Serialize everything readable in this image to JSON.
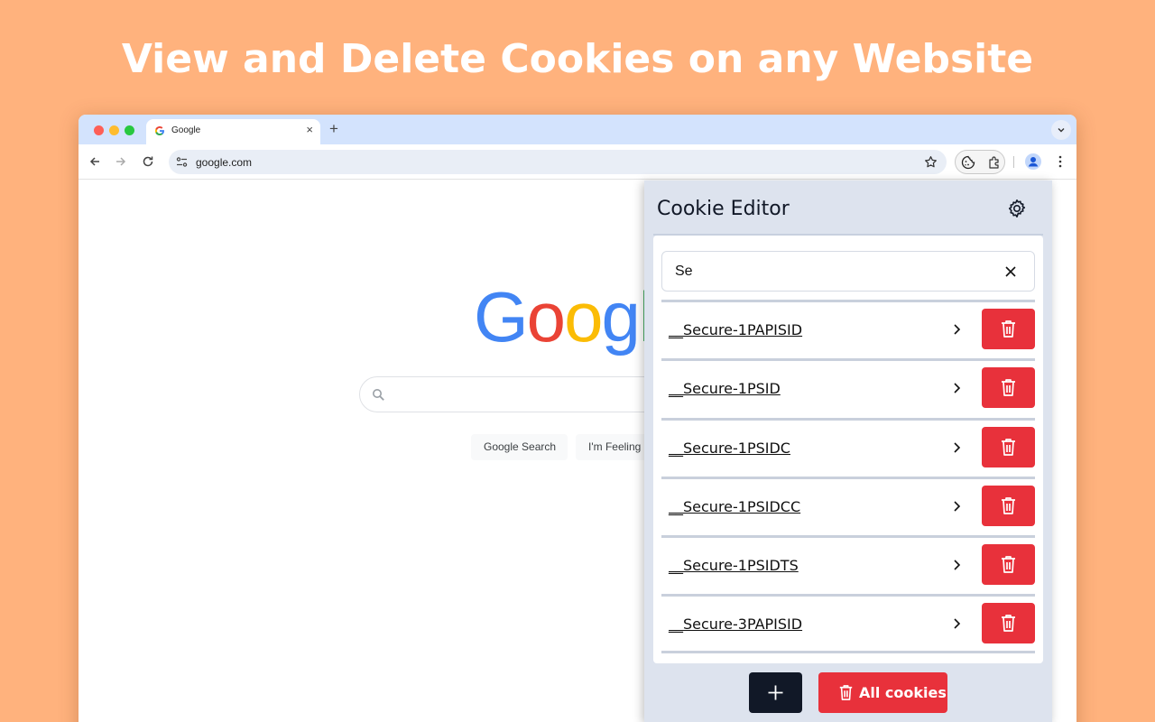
{
  "headline": "View and Delete Cookies on any Website",
  "browser": {
    "tab_title": "Google",
    "address": "google.com"
  },
  "google_page": {
    "logo_letters": [
      "G",
      "o",
      "o",
      "g",
      "l"
    ],
    "buttons": [
      "Google Search",
      "I'm Feeling L"
    ]
  },
  "popup": {
    "title": "Cookie Editor",
    "search_value": "Se",
    "cookies": [
      "__Secure-1PAPISID",
      "__Secure-1PSID",
      "__Secure-1PSIDC",
      "__Secure-1PSIDCC",
      "__Secure-1PSIDTS",
      "__Secure-3PAPISID"
    ],
    "delete_all_label": "All cookies"
  },
  "colors": {
    "background": "#ffb27d",
    "delete_red": "#e8313b",
    "add_dark": "#111827",
    "popup_bg": "#dde3ee"
  }
}
